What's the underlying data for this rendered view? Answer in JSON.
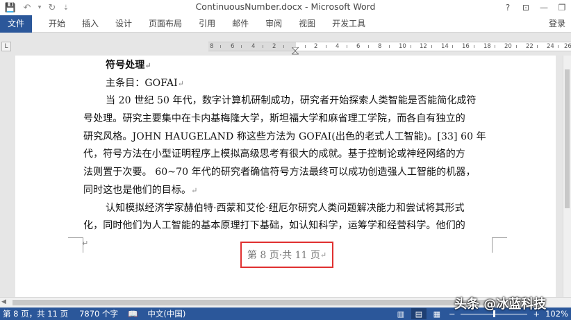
{
  "window": {
    "title": "ContinuousNumber.docx - Microsoft Word",
    "help": "?",
    "controls": {
      "ribbon_display": "⊡",
      "minimize": "—",
      "restore": "❐"
    }
  },
  "qat": {
    "save": "💾",
    "undo": "↶",
    "undo_dd": "▾",
    "redo": "↻",
    "customize": "⇣"
  },
  "ribbon": {
    "tabs": [
      "文件",
      "开始",
      "插入",
      "设计",
      "页面布局",
      "引用",
      "邮件",
      "审阅",
      "视图",
      "开发工具"
    ],
    "login": "登录"
  },
  "ruler": {
    "tab_selector": "L",
    "labels": [
      "8",
      "6",
      "4",
      "2",
      "",
      "2",
      "4",
      "6",
      "8",
      "10",
      "12",
      "14",
      "16",
      "18",
      "20",
      "22",
      "24",
      "26"
    ]
  },
  "document": {
    "lines": [
      {
        "text": "符号处理",
        "bold": true,
        "indent": 1,
        "mark": "↵"
      },
      {
        "text": "主条目：GOFAI",
        "indent": 1,
        "mark": "↵"
      },
      {
        "text": "当 20 世纪 50 年代，数字计算机研制成功，研究者开始探索人类智能是否能简化成符",
        "indent": 1,
        "mark": ""
      },
      {
        "text": "号处理。研究主要集中在卡内基梅隆大学，斯坦福大学和麻省理工学院，而各自有独立的",
        "indent": 0,
        "mark": ""
      },
      {
        "text": "研究风格。JOHN HAUGELAND 称这些方法为 GOFAI(出色的老式人工智能)。[33] 60 年",
        "indent": 0,
        "mark": ""
      },
      {
        "text": "代，符号方法在小型证明程序上模拟高级思考有很大的成就。基于控制论或神经网络的方",
        "indent": 0,
        "mark": ""
      },
      {
        "text": "法则置于次要。 60~70 年代的研究者确信符号方法最终可以成功创造强人工智能的机器，",
        "indent": 0,
        "mark": ""
      },
      {
        "text": "同时这也是他们的目标。",
        "indent": 0,
        "mark": "↵"
      },
      {
        "text": "认知模拟经济学家赫伯特·西蒙和艾伦·纽厄尔研究人类问题解决能力和尝试将其形式",
        "indent": 1,
        "mark": ""
      },
      {
        "text": "化，同时他们为人工智能的基本原理打下基础，如认知科学，运筹学和经营科学。他们的",
        "indent": 0,
        "mark": ""
      }
    ],
    "footer_mark": "↵",
    "footer_text": "第 8 页·共 11 页",
    "footer_end_mark": "↵"
  },
  "status": {
    "page": "第 8 页，共 11 页",
    "words": "7870 个字",
    "proof": "📖",
    "language": "中文(中国)",
    "zoom_minus": "−",
    "zoom_plus": "+",
    "zoom": "102%",
    "zoom_level": 0.5
  },
  "watermark": "头条 @冰蓝科技"
}
